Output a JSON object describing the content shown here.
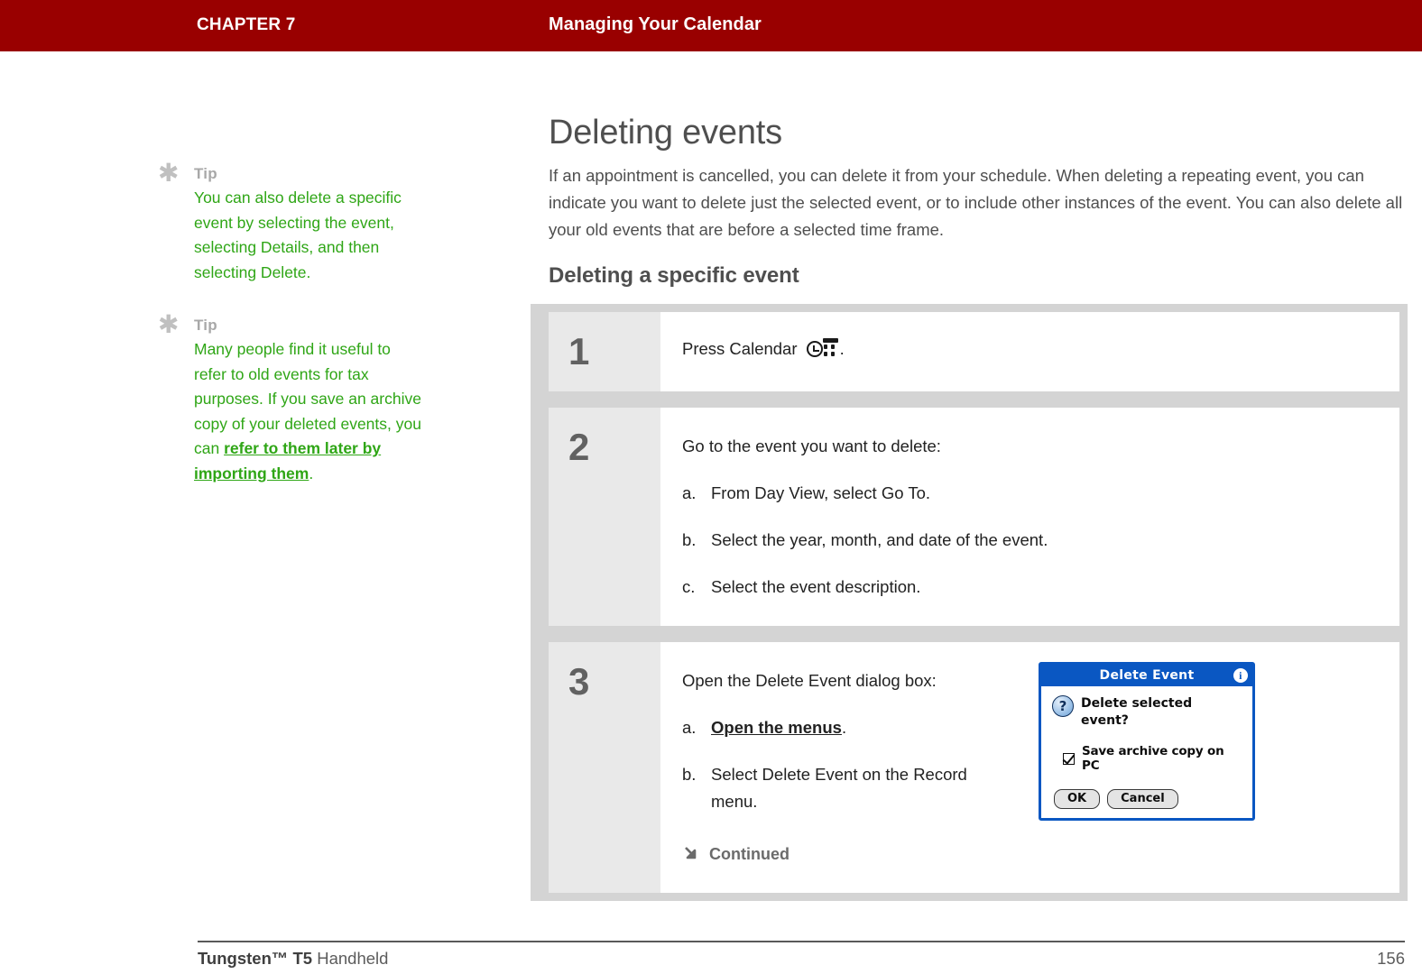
{
  "header": {
    "chapter": "CHAPTER 7",
    "title": "Managing Your Calendar"
  },
  "sidebar": {
    "tips": [
      {
        "icon": "asterisk-icon",
        "label": "Tip",
        "body_before": "You can also delete a specific event by selecting the event, selecting Details, and then selecting Delete.",
        "link": "",
        "body_after": ""
      },
      {
        "icon": "asterisk-icon",
        "label": "Tip",
        "body_before": "Many people find it useful to refer to old events for tax purposes. If you save an archive copy of your deleted events, you can ",
        "link": "refer to them later by importing them",
        "body_after": "."
      }
    ]
  },
  "main": {
    "heading": "Deleting events",
    "intro": "If an appointment is cancelled, you can delete it from your schedule. When deleting a repeating event, you can indicate you want to delete just the selected event, or to include other instances of the event. You can also delete all your old events that are before a selected time frame.",
    "subheading": "Deleting a specific event",
    "steps": [
      {
        "number": "1",
        "lead_before": "Press Calendar ",
        "icon": "calendar-icon",
        "lead_after": ".",
        "substeps": []
      },
      {
        "number": "2",
        "lead_before": "Go to the event you want to delete:",
        "icon": "",
        "lead_after": "",
        "substeps": [
          {
            "marker": "a.",
            "text": "From Day View, select Go To.",
            "link": "",
            "text_after": ""
          },
          {
            "marker": "b.",
            "text": "Select the year, month, and date of the event.",
            "link": "",
            "text_after": ""
          },
          {
            "marker": "c.",
            "text": "Select the event description.",
            "link": "",
            "text_after": ""
          }
        ]
      },
      {
        "number": "3",
        "lead_before": "Open the Delete Event dialog box:",
        "icon": "",
        "lead_after": "",
        "substeps": [
          {
            "marker": "a.",
            "text": "",
            "link": "Open the menus",
            "text_after": "."
          },
          {
            "marker": "b.",
            "text": "Select Delete Event on the Record menu.",
            "link": "",
            "text_after": ""
          }
        ],
        "continued_label": "Continued",
        "continued_icon": "arrow-down-right-icon"
      }
    ]
  },
  "dialog": {
    "title": "Delete Event",
    "info_icon": "info-icon",
    "question_icon": "question-icon",
    "prompt": "Delete selected event?",
    "checkbox_icon": "checked-checkbox-icon",
    "checkbox_label": "Save archive copy on PC",
    "checkbox_checked": true,
    "buttons": [
      {
        "label": "OK"
      },
      {
        "label": "Cancel"
      }
    ]
  },
  "footer": {
    "product_bold": "Tungsten™ T5",
    "product_rest": " Handheld",
    "page_number": "156"
  },
  "colors": {
    "header_red": "#990000",
    "tip_green": "#2fa616",
    "tip_label_gray": "#a8a8a8",
    "table_frame_gray": "#d4d4d4",
    "step_num_bg": "#e9e9e9",
    "dialog_blue": "#0a57c2",
    "body_text": "#4f4f4f"
  }
}
